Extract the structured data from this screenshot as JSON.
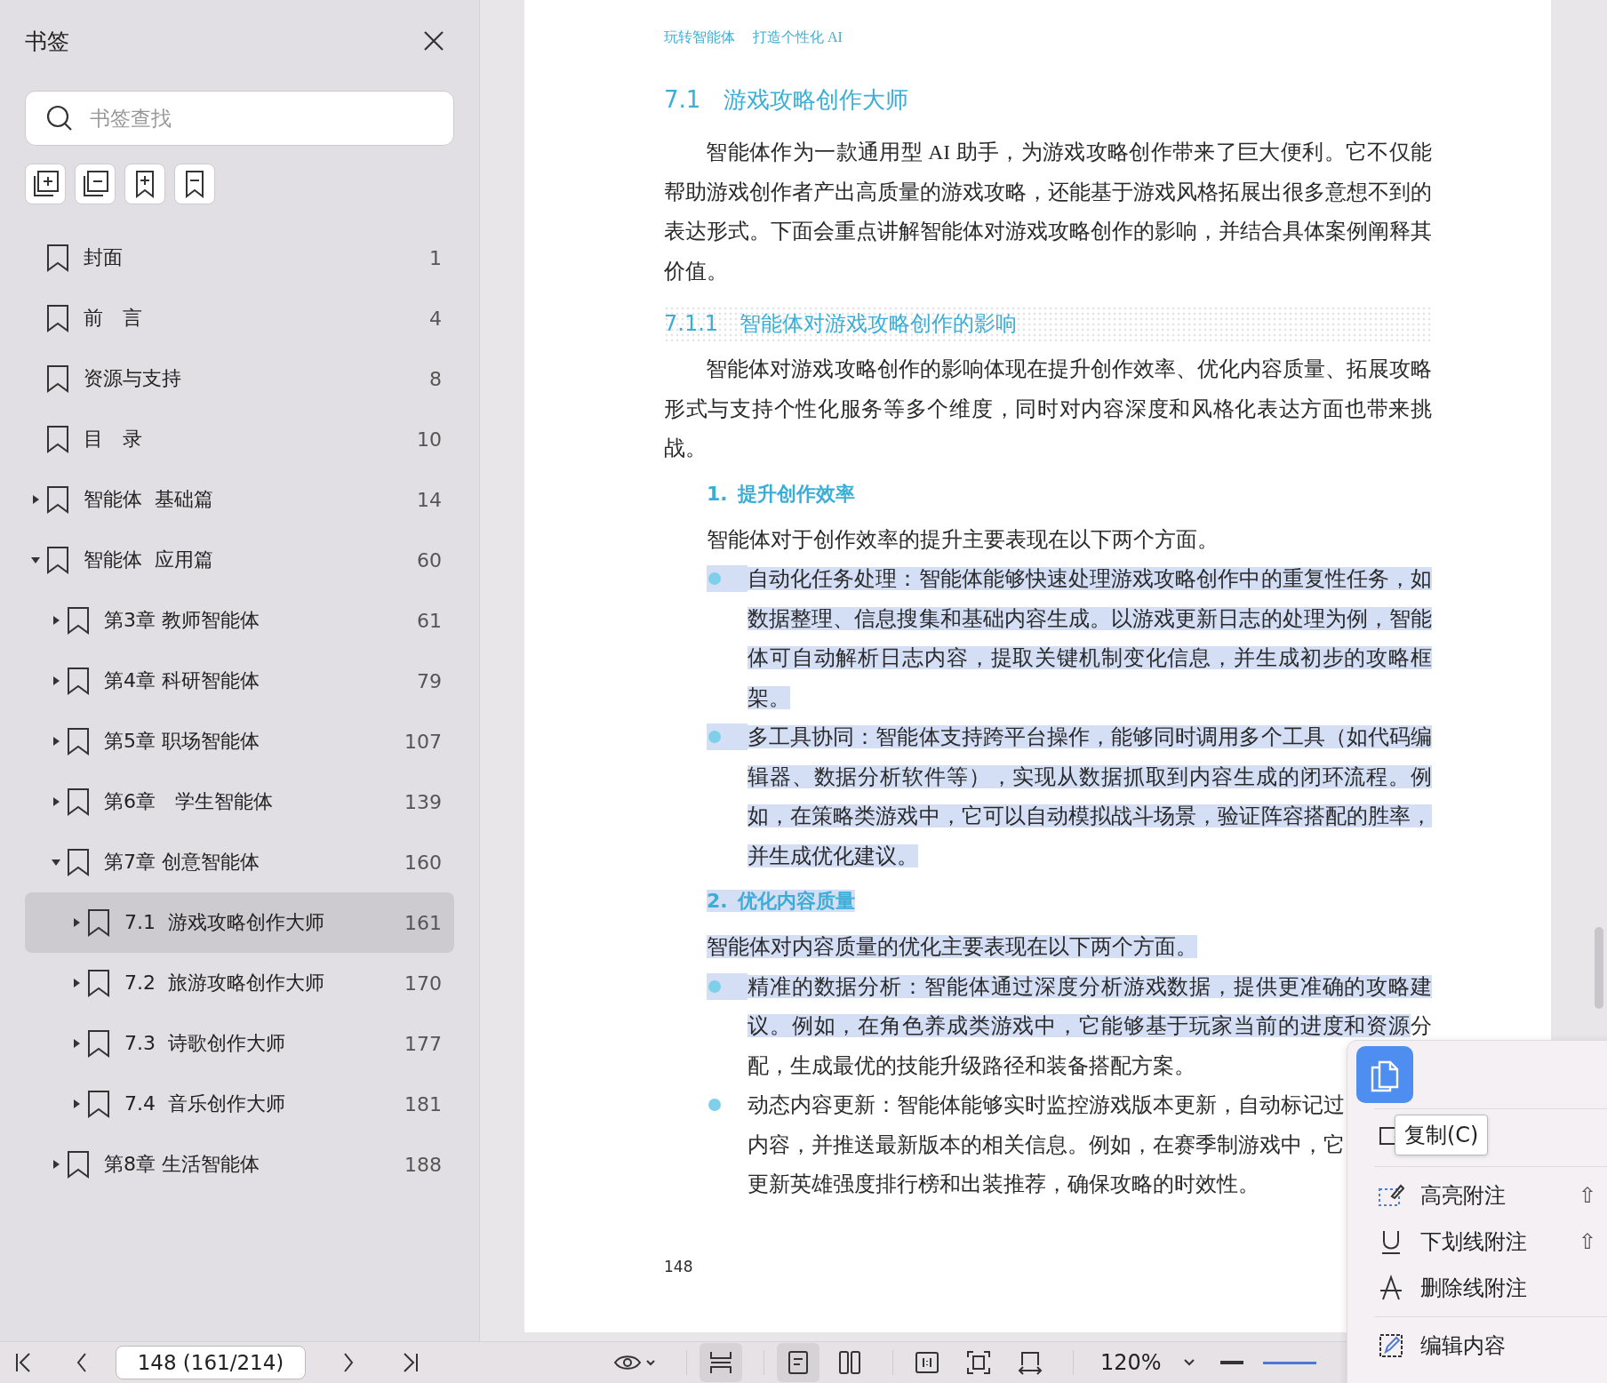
{
  "sidebar": {
    "title": "书签",
    "search": {
      "placeholder": "书签查找"
    },
    "tools": [
      {
        "kind": "expand-all"
      },
      {
        "kind": "collapse-all"
      },
      {
        "kind": "add-bookmark"
      },
      {
        "kind": "remove-bookmark"
      }
    ],
    "tree": [
      {
        "label": "封面",
        "page": "1",
        "kind": "leaf",
        "selected": false
      },
      {
        "label": "前　言",
        "page": "4",
        "kind": "leaf",
        "selected": false
      },
      {
        "label": "资源与支持",
        "page": "8",
        "kind": "leaf",
        "selected": false
      },
      {
        "label": "目　录",
        "page": "10",
        "kind": "leaf",
        "selected": false
      },
      {
        "label": "智能体  基础篇",
        "page": "14",
        "kind": "branch",
        "expanded": false,
        "selected": false
      },
      {
        "label": "智能体  应用篇",
        "page": "60",
        "kind": "branch",
        "expanded": true,
        "selected": false,
        "children": [
          {
            "label": "第3章 教师智能体",
            "page": "61",
            "kind": "branch",
            "expanded": false,
            "selected": false
          },
          {
            "label": "第4章 科研智能体",
            "page": "79",
            "kind": "branch",
            "expanded": false,
            "selected": false
          },
          {
            "label": "第5章 职场智能体",
            "page": "107",
            "kind": "branch",
            "expanded": false,
            "selected": false
          },
          {
            "label": "第6章　学生智能体",
            "page": "139",
            "kind": "branch",
            "expanded": false,
            "selected": false
          },
          {
            "label": "第7章 创意智能体",
            "page": "160",
            "kind": "branch",
            "expanded": true,
            "selected": false,
            "children": [
              {
                "label": "7.1  游戏攻略创作大师",
                "page": "161",
                "kind": "branch",
                "expanded": false,
                "selected": true
              },
              {
                "label": "7.2  旅游攻略创作大师",
                "page": "170",
                "kind": "branch",
                "expanded": false,
                "selected": false
              },
              {
                "label": "7.3  诗歌创作大师",
                "page": "177",
                "kind": "branch",
                "expanded": false,
                "selected": false
              },
              {
                "label": "7.4  音乐创作大师",
                "page": "181",
                "kind": "branch",
                "expanded": false,
                "selected": false
              }
            ]
          },
          {
            "label": "第8章 生活智能体",
            "page": "188",
            "kind": "branch",
            "expanded": false,
            "selected": false
          }
        ]
      }
    ]
  },
  "page": {
    "header": [
      "玩转智能体",
      "打造个性化 AI"
    ],
    "blocks": [
      {
        "kind": "h1",
        "number": "7.1",
        "text": "游戏攻略创作大师"
      },
      {
        "kind": "para",
        "segments": [
          {
            "text": "智能体作为一款通用型 AI 助手，为游戏攻略创作带来了巨大便利。它不仅能帮助游戏创作者产出高质量的游戏攻略，还能基于游戏风格拓展出很多意想不到的表达形式。下面会重点讲解智能体对游戏攻略创作的影响，并结合具体案例阐释其价值。",
            "highlighted": false
          }
        ]
      },
      {
        "kind": "h2",
        "number": "7.1.1",
        "text": "智能体对游戏攻略创作的影响"
      },
      {
        "kind": "para",
        "segments": [
          {
            "text": "智能体对游戏攻略创作的影响体现在提升创作效率、优化内容质量、拓展攻略形式与支持个性化服务等多个维度，同时对内容深度和风格化表达方面也带来挑战。",
            "highlighted": false
          }
        ]
      },
      {
        "kind": "h3",
        "number": "1.",
        "text": "提升创作效率",
        "highlighted": false
      },
      {
        "kind": "para",
        "segments": [
          {
            "text": "智能体对于创作效率的提升主要表现在以下两个方面。",
            "highlighted": false
          }
        ]
      },
      {
        "kind": "bullet",
        "segments": [
          {
            "text": "自动化任务处理：智能体能够快速处理游戏攻略创作中的重复性任务，如数据整理、信息搜集和基础内容生成。以游戏更新日志的处理为例，智能体可自动解析日志内容，提取关键机制变化信息，并生成初步的攻略框架。",
            "highlighted": true
          }
        ]
      },
      {
        "kind": "bullet",
        "segments": [
          {
            "text": "多工具协同：智能体支持跨平台操作，能够同时调用多个工具（如代码编辑器、数据分析软件等），实现从数据抓取到内容生成的闭环流程。例如，在策略类游戏中，它可以自动模拟战斗场景，验证阵容搭配的胜率，并生成优化建议。",
            "highlighted": true
          }
        ]
      },
      {
        "kind": "h3",
        "number": "2.",
        "text": "优化内容质量",
        "highlighted": true
      },
      {
        "kind": "para",
        "segments": [
          {
            "text": "智能体对内容质量的优化主要表现在以下两个方面。",
            "highlighted": true
          }
        ]
      },
      {
        "kind": "bullet",
        "segments": [
          {
            "text": "精准的数据分析：智能体通过深度分析游戏数据，提供更准确的攻略建议。例如，在角色养成类游戏中，它能够基于玩家当前的进度和资源",
            "highlighted": true
          },
          {
            "text": "分配，生成最优的技能升级路径和装备搭配方案。",
            "highlighted": false
          }
        ]
      },
      {
        "kind": "bullet",
        "lines": [
          "动态内容更新：智能体能够实时监控游戏版本更新，自动标记过",
          "内容，并推送最新版本的相关信息。例如，在赛季制游戏中，它",
          "更新英雄强度排行榜和出装推荐，确保攻略的时效性。"
        ],
        "highlighted": false
      }
    ],
    "page_number": "148"
  },
  "toolbar": {
    "page_field": "148 (161/214)",
    "zoom": "120%",
    "tool_groups": [
      [
        {
          "kind": "eye-menu",
          "selected": false
        }
      ],
      [
        {
          "kind": "fit-height",
          "selected": true
        }
      ],
      [
        {
          "kind": "single-page",
          "selected": true
        },
        {
          "kind": "two-page",
          "selected": false
        }
      ],
      [
        {
          "kind": "actual-size",
          "selected": false
        },
        {
          "kind": "fit-page",
          "selected": false
        },
        {
          "kind": "fit-width",
          "selected": false
        }
      ]
    ]
  },
  "context_menu": {
    "tooltip": "复制(C)",
    "items": [
      {
        "kind": "highlight",
        "label": "高亮附注",
        "shortcut": "⇧"
      },
      {
        "kind": "underline",
        "label": "下划线附注",
        "shortcut": "⇧"
      },
      {
        "kind": "strike",
        "label": "删除线附注"
      },
      {
        "kind": "edit",
        "label": "编辑内容"
      }
    ]
  }
}
